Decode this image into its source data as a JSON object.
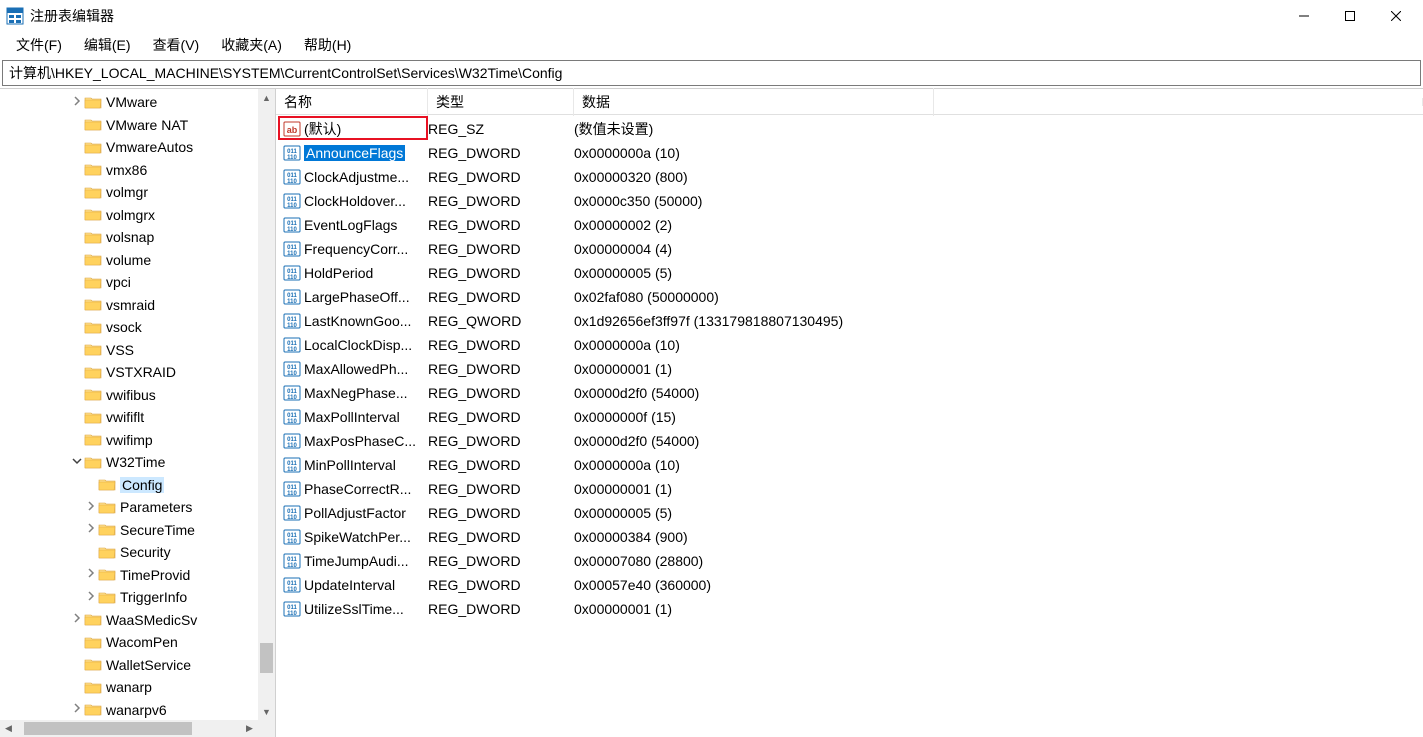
{
  "window": {
    "title": "注册表编辑器"
  },
  "menu": {
    "file": "文件(F)",
    "edit": "编辑(E)",
    "view": "查看(V)",
    "favorites": "收藏夹(A)",
    "help": "帮助(H)"
  },
  "address": "计算机\\HKEY_LOCAL_MACHINE\\SYSTEM\\CurrentControlSet\\Services\\W32Time\\Config",
  "tree": [
    {
      "indent": 5,
      "chevron": ">",
      "label": "VMware"
    },
    {
      "indent": 5,
      "chevron": "",
      "label": "VMware NAT"
    },
    {
      "indent": 5,
      "chevron": "",
      "label": "VmwareAutos"
    },
    {
      "indent": 5,
      "chevron": "",
      "label": "vmx86"
    },
    {
      "indent": 5,
      "chevron": "",
      "label": "volmgr"
    },
    {
      "indent": 5,
      "chevron": "",
      "label": "volmgrx"
    },
    {
      "indent": 5,
      "chevron": "",
      "label": "volsnap"
    },
    {
      "indent": 5,
      "chevron": "",
      "label": "volume"
    },
    {
      "indent": 5,
      "chevron": "",
      "label": "vpci"
    },
    {
      "indent": 5,
      "chevron": "",
      "label": "vsmraid"
    },
    {
      "indent": 5,
      "chevron": "",
      "label": "vsock"
    },
    {
      "indent": 5,
      "chevron": "",
      "label": "VSS"
    },
    {
      "indent": 5,
      "chevron": "",
      "label": "VSTXRAID"
    },
    {
      "indent": 5,
      "chevron": "",
      "label": "vwifibus"
    },
    {
      "indent": 5,
      "chevron": "",
      "label": "vwififlt"
    },
    {
      "indent": 5,
      "chevron": "",
      "label": "vwifimp"
    },
    {
      "indent": 5,
      "chevron": "v",
      "label": "W32Time"
    },
    {
      "indent": 6,
      "chevron": "",
      "label": "Config",
      "selected": true
    },
    {
      "indent": 6,
      "chevron": ">",
      "label": "Parameters"
    },
    {
      "indent": 6,
      "chevron": ">",
      "label": "SecureTime"
    },
    {
      "indent": 6,
      "chevron": "",
      "label": "Security"
    },
    {
      "indent": 6,
      "chevron": ">",
      "label": "TimeProvid"
    },
    {
      "indent": 6,
      "chevron": ">",
      "label": "TriggerInfo"
    },
    {
      "indent": 5,
      "chevron": ">",
      "label": "WaaSMedicSv"
    },
    {
      "indent": 5,
      "chevron": "",
      "label": "WacomPen"
    },
    {
      "indent": 5,
      "chevron": "",
      "label": "WalletService"
    },
    {
      "indent": 5,
      "chevron": "",
      "label": "wanarp"
    },
    {
      "indent": 5,
      "chevron": ">",
      "label": "wanarpv6"
    }
  ],
  "columns": {
    "name": "名称",
    "type": "类型",
    "data": "数据"
  },
  "values": [
    {
      "icon": "str",
      "name": "(默认)",
      "type": "REG_SZ",
      "data": "(数值未设置)"
    },
    {
      "icon": "bin",
      "name": "AnnounceFlags",
      "type": "REG_DWORD",
      "data": "0x0000000a (10)",
      "selected": true
    },
    {
      "icon": "bin",
      "name": "ClockAdjustme...",
      "type": "REG_DWORD",
      "data": "0x00000320 (800)"
    },
    {
      "icon": "bin",
      "name": "ClockHoldover...",
      "type": "REG_DWORD",
      "data": "0x0000c350 (50000)"
    },
    {
      "icon": "bin",
      "name": "EventLogFlags",
      "type": "REG_DWORD",
      "data": "0x00000002 (2)"
    },
    {
      "icon": "bin",
      "name": "FrequencyCorr...",
      "type": "REG_DWORD",
      "data": "0x00000004 (4)"
    },
    {
      "icon": "bin",
      "name": "HoldPeriod",
      "type": "REG_DWORD",
      "data": "0x00000005 (5)"
    },
    {
      "icon": "bin",
      "name": "LargePhaseOff...",
      "type": "REG_DWORD",
      "data": "0x02faf080 (50000000)"
    },
    {
      "icon": "bin",
      "name": "LastKnownGoo...",
      "type": "REG_QWORD",
      "data": "0x1d92656ef3ff97f (133179818807130495)"
    },
    {
      "icon": "bin",
      "name": "LocalClockDisp...",
      "type": "REG_DWORD",
      "data": "0x0000000a (10)"
    },
    {
      "icon": "bin",
      "name": "MaxAllowedPh...",
      "type": "REG_DWORD",
      "data": "0x00000001 (1)"
    },
    {
      "icon": "bin",
      "name": "MaxNegPhase...",
      "type": "REG_DWORD",
      "data": "0x0000d2f0 (54000)"
    },
    {
      "icon": "bin",
      "name": "MaxPollInterval",
      "type": "REG_DWORD",
      "data": "0x0000000f (15)"
    },
    {
      "icon": "bin",
      "name": "MaxPosPhaseC...",
      "type": "REG_DWORD",
      "data": "0x0000d2f0 (54000)"
    },
    {
      "icon": "bin",
      "name": "MinPollInterval",
      "type": "REG_DWORD",
      "data": "0x0000000a (10)"
    },
    {
      "icon": "bin",
      "name": "PhaseCorrectR...",
      "type": "REG_DWORD",
      "data": "0x00000001 (1)"
    },
    {
      "icon": "bin",
      "name": "PollAdjustFactor",
      "type": "REG_DWORD",
      "data": "0x00000005 (5)"
    },
    {
      "icon": "bin",
      "name": "SpikeWatchPer...",
      "type": "REG_DWORD",
      "data": "0x00000384 (900)"
    },
    {
      "icon": "bin",
      "name": "TimeJumpAudi...",
      "type": "REG_DWORD",
      "data": "0x00007080 (28800)"
    },
    {
      "icon": "bin",
      "name": "UpdateInterval",
      "type": "REG_DWORD",
      "data": "0x00057e40 (360000)"
    },
    {
      "icon": "bin",
      "name": "UtilizeSslTime...",
      "type": "REG_DWORD",
      "data": "0x00000001 (1)"
    }
  ]
}
